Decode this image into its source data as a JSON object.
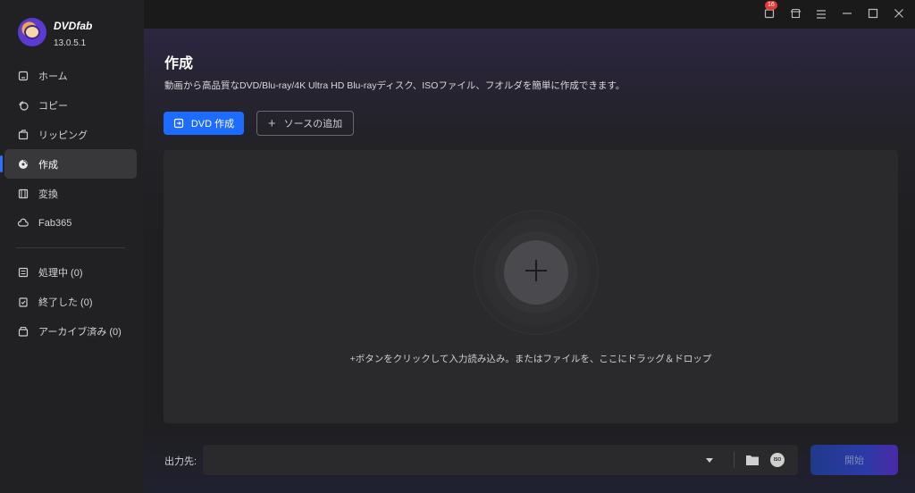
{
  "app": {
    "name": "DVDfab",
    "version": "13.0.5.1"
  },
  "sidebar": {
    "items": [
      {
        "label": "ホーム",
        "icon": "home-icon"
      },
      {
        "label": "コピー",
        "icon": "copy-icon"
      },
      {
        "label": "リッピング",
        "icon": "ripper-icon"
      },
      {
        "label": "作成",
        "icon": "disc-icon",
        "active": true
      },
      {
        "label": "変換",
        "icon": "film-icon"
      },
      {
        "label": "Fab365",
        "icon": "cloud-icon"
      }
    ],
    "task_items": [
      {
        "label": "処理中 (0)",
        "icon": "processing-icon"
      },
      {
        "label": "終了した (0)",
        "icon": "finished-icon"
      },
      {
        "label": "アーカイブ済み (0)",
        "icon": "archive-icon"
      }
    ]
  },
  "titlebar": {
    "notification_count": "16",
    "icons": [
      "notification-icon",
      "store-icon",
      "menu-icon",
      "minimize-icon",
      "maximize-icon",
      "close-icon"
    ]
  },
  "main": {
    "title": "作成",
    "subtitle": "動画から高品質なDVD/Blu-ray/4K Ultra HD Blu-rayディスク、ISOファイル、フオルダを簡単に作成できます。",
    "primary_button": "DVD 作成",
    "add_source_button": "ソースの追加",
    "drop_hint": "+ボタンをクリックして入力読み込み。またはファイルを、ここにドラッグ＆ドロップ"
  },
  "output": {
    "label": "出力先:",
    "value": "",
    "iso_label": "ISO",
    "start_button": "開始"
  },
  "colors": {
    "accent": "#1e6bff",
    "badge": "#e53935",
    "background": "#1c1c1e"
  }
}
